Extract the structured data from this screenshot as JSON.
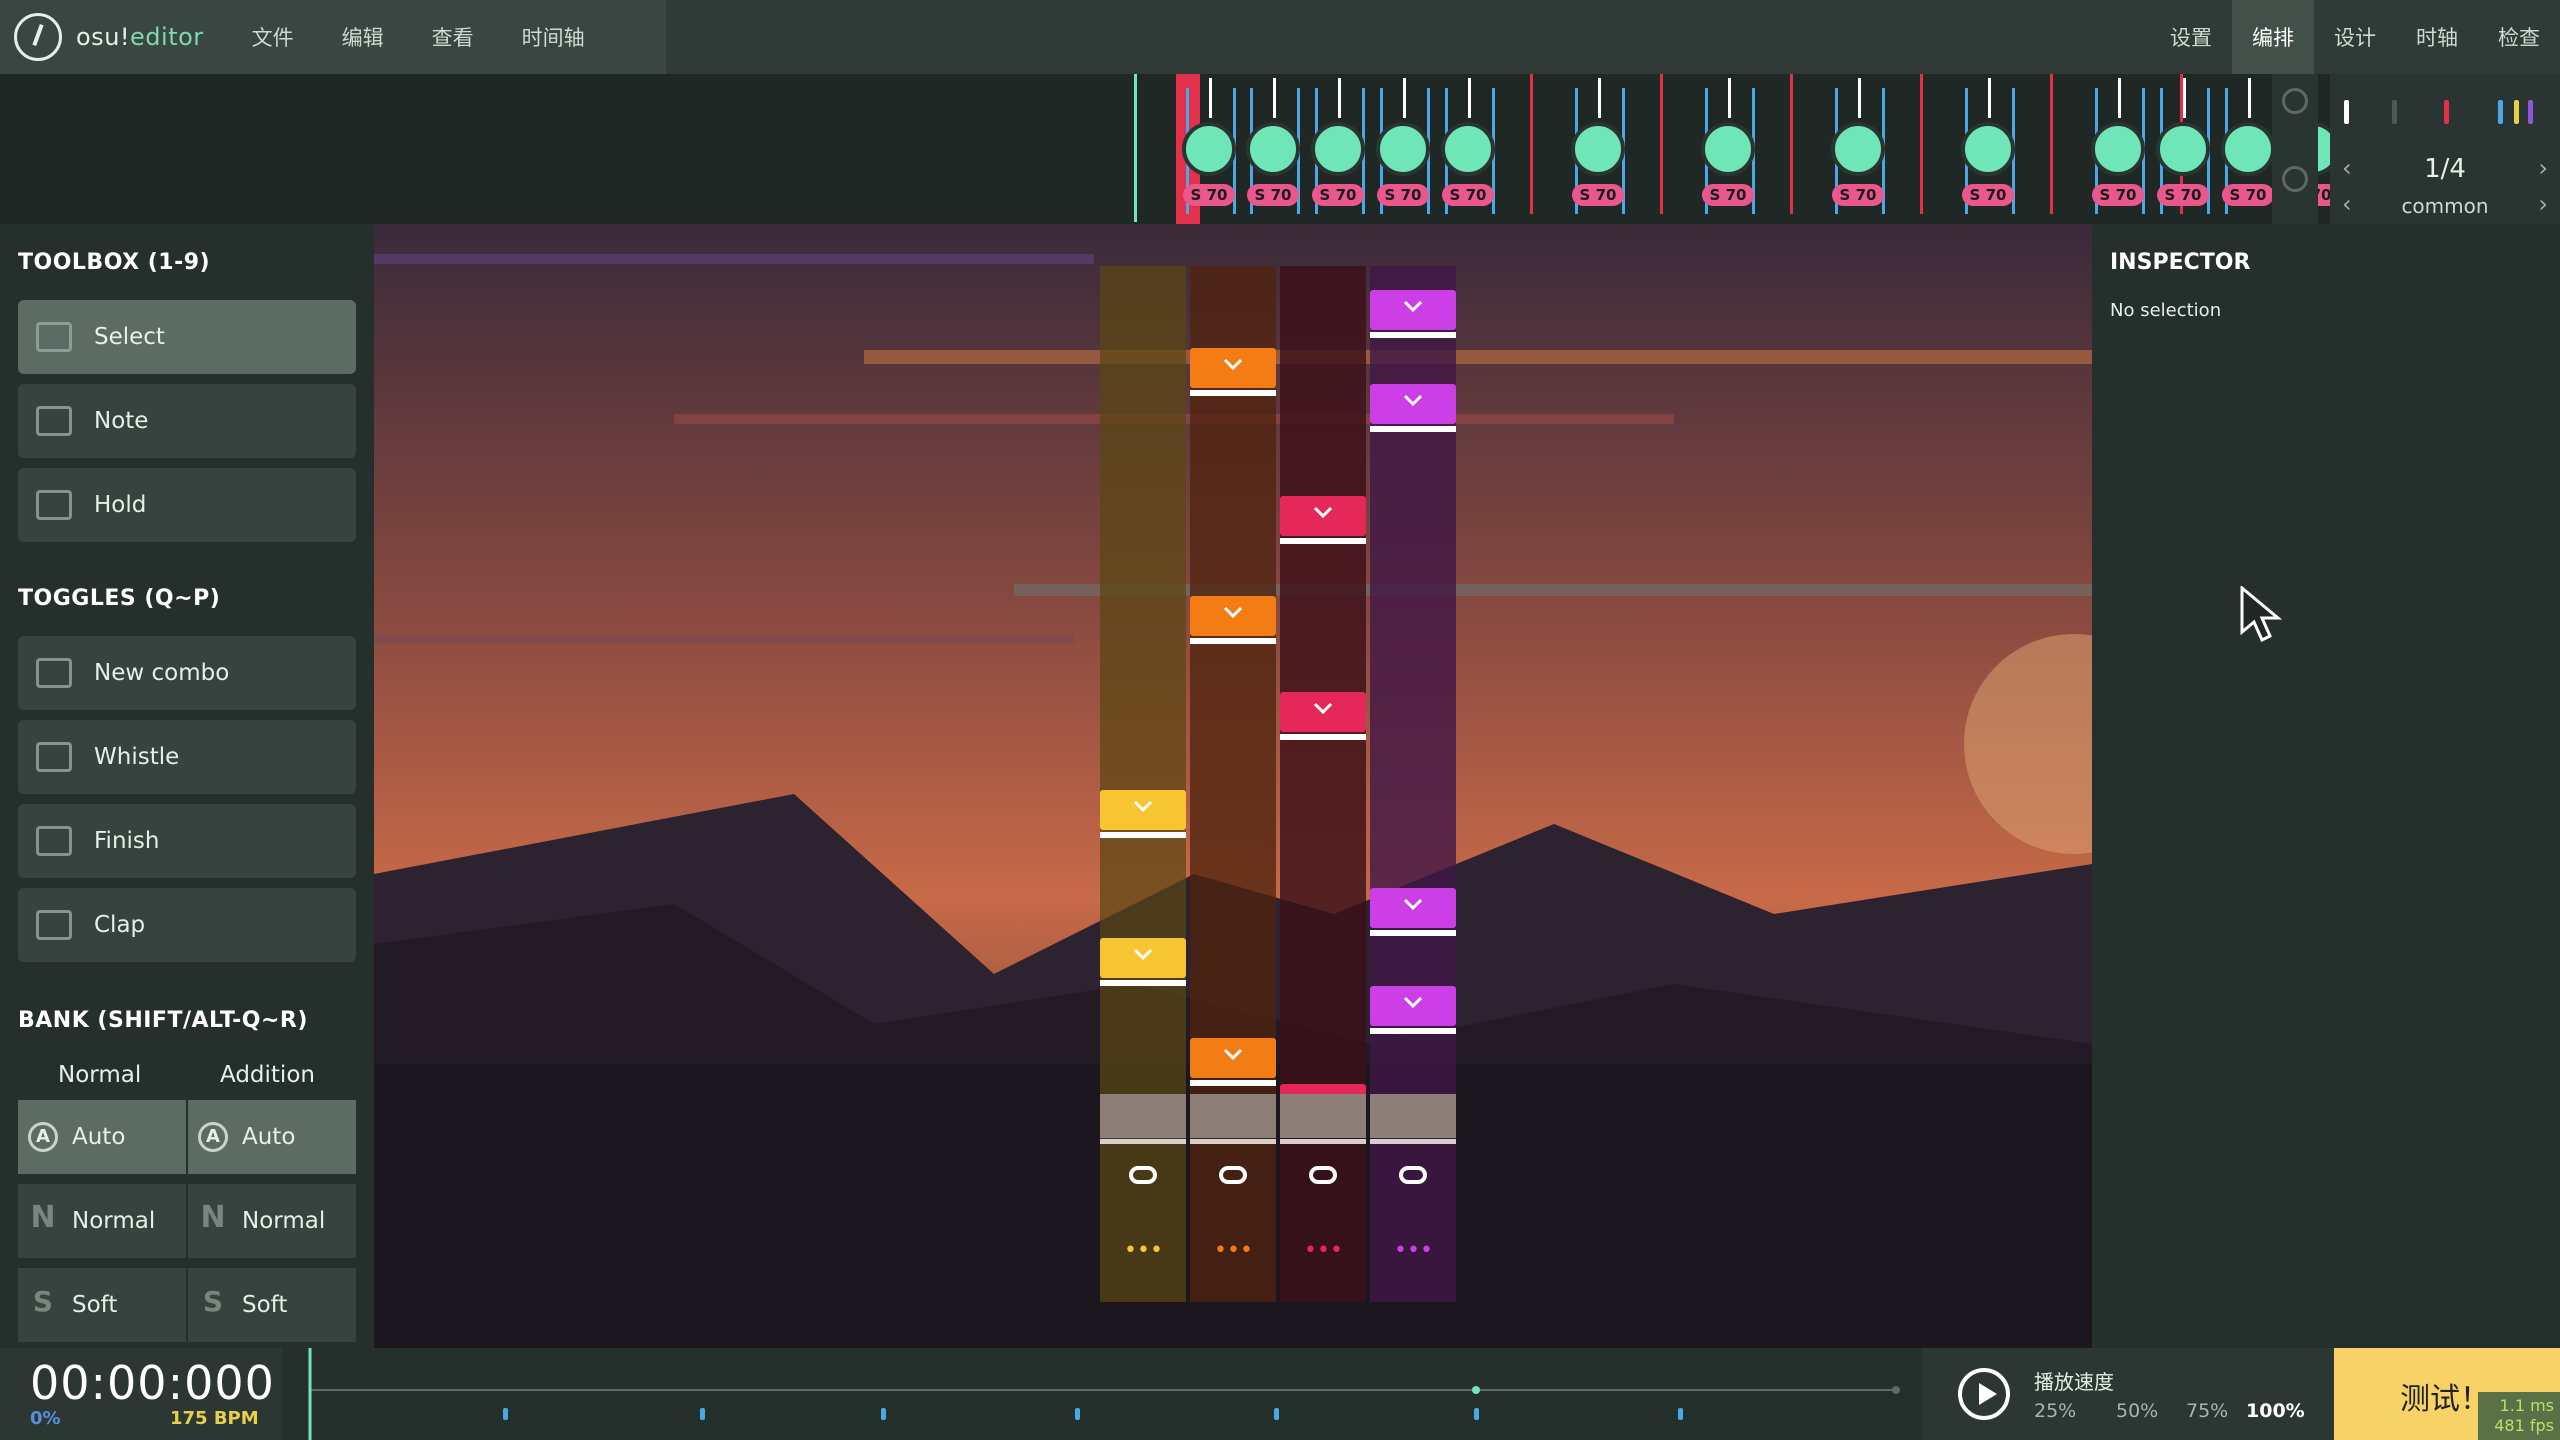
{
  "menubar": {
    "brand_main": "osu!",
    "brand_accent": "editor",
    "menus": [
      "文件",
      "编辑",
      "查看",
      "时间轴"
    ],
    "screens": [
      "设置",
      "编排",
      "设计",
      "时轴",
      "检查"
    ],
    "active_screen": "编排"
  },
  "timeline": {
    "badge_label": "S 70",
    "note_count": 13,
    "beat_snap": "1/4",
    "beat_type": "common"
  },
  "toolbox": {
    "title": "TOOLBOX (1-9)",
    "tools": [
      "Select",
      "Note",
      "Hold"
    ],
    "active_tool": "Select"
  },
  "toggles": {
    "title": "TOGGLES (Q~P)",
    "items": [
      "New combo",
      "Whistle",
      "Finish",
      "Clap"
    ]
  },
  "bank": {
    "title": "BANK (SHIFT/ALT-Q~R)",
    "normal_header": "Normal",
    "addition_header": "Addition",
    "rows": [
      {
        "normal": "Auto",
        "addition": "Auto",
        "glyph": "A"
      },
      {
        "normal": "Normal",
        "addition": "Normal",
        "glyph": "N"
      },
      {
        "normal": "Soft",
        "addition": "Soft",
        "glyph": "S"
      }
    ]
  },
  "playfield": {
    "columns": [
      {
        "color": "#f7c531",
        "dots": "•••"
      },
      {
        "color": "#f47c14",
        "dots": "•••"
      },
      {
        "color": "#e6275a",
        "dots": "•••"
      },
      {
        "color": "#cc3ee6",
        "dots": "•••"
      }
    ]
  },
  "inspector": {
    "title": "INSPECTOR",
    "selection": "No selection"
  },
  "bottom": {
    "time": "00:00:000",
    "percent": "0%",
    "bpm": "175 BPM",
    "rate_label": "播放速度",
    "rates": [
      "25%",
      "50%",
      "75%",
      "100%"
    ],
    "active_rate": "100%",
    "test_label": "测试！",
    "frame_time": "1.1 ms",
    "fps": "481 fps"
  },
  "colors": {
    "accent": "#7fd8b5",
    "note_knob": "#6fe6b8",
    "badge": "#e9578d",
    "test_button": "#f6d267"
  }
}
